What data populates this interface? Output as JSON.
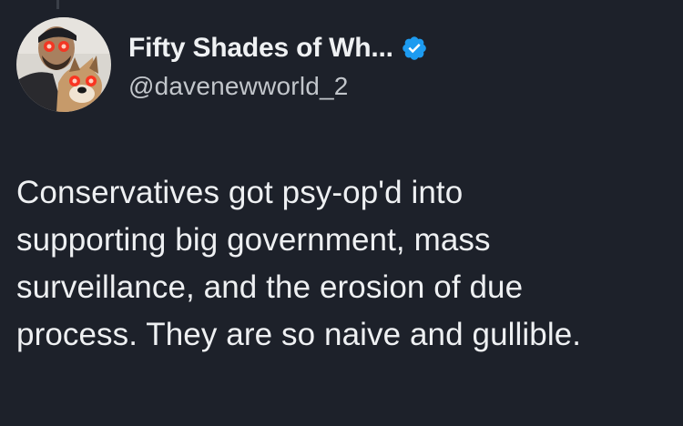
{
  "author": {
    "display_name": "Fifty Shades of Wh...",
    "handle": "@davenewworld_2",
    "verified_icon": "verified-badge-icon",
    "avatar": "profile-avatar",
    "badge_color": "#1d9bf0"
  },
  "tweet": {
    "lines": [
      "Conservatives got psy-op'd into",
      "supporting big government, mass",
      "surveillance, and the erosion of due",
      "process. They are so naive and gullible."
    ]
  },
  "theme": {
    "background": "#1d212a",
    "text": "#eef0f2",
    "secondary_text": "#c2c6cb"
  }
}
